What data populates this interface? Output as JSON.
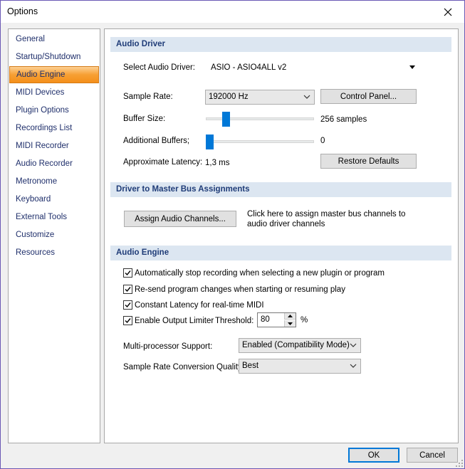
{
  "window": {
    "title": "Options"
  },
  "sidebar": {
    "items": [
      {
        "label": "General"
      },
      {
        "label": "Startup/Shutdown"
      },
      {
        "label": "Audio Engine"
      },
      {
        "label": "MIDI Devices"
      },
      {
        "label": "Plugin Options"
      },
      {
        "label": "Recordings List"
      },
      {
        "label": "MIDI Recorder"
      },
      {
        "label": "Audio Recorder"
      },
      {
        "label": "Metronome"
      },
      {
        "label": "Keyboard"
      },
      {
        "label": "External Tools"
      },
      {
        "label": "Customize"
      },
      {
        "label": "Resources"
      }
    ],
    "selected": "Audio Engine",
    "selected_color": "#f7a033"
  },
  "audio_driver": {
    "header": "Audio Driver",
    "select_label": "Select Audio Driver:",
    "driver_value": "ASIO - ASIO4ALL v2",
    "sample_rate_label": "Sample Rate:",
    "sample_rate_value": "192000 Hz",
    "control_panel_button": "Control Panel...",
    "buffer_size_label": "Buffer Size:",
    "buffer_size_value": "256 samples",
    "buffer_size_level": 0.16,
    "additional_buffers_label": "Additional Buffers;",
    "additional_buffers_value": "0",
    "additional_buffers_level": 0.0,
    "latency_label": "Approximate Latency:",
    "latency_value": "1,3 ms",
    "restore_defaults_button": "Restore Defaults"
  },
  "bus": {
    "header": "Driver to Master Bus Assignments",
    "assign_button": "Assign Audio Channels...",
    "help_line1": "Click here to assign master bus channels to",
    "help_line2": "audio driver channels"
  },
  "engine": {
    "header": "Audio Engine",
    "options": [
      {
        "label": "Automatically stop recording when selecting a new plugin or program",
        "checked": true
      },
      {
        "label": "Re-send program changes when starting or resuming play",
        "checked": true
      },
      {
        "label": "Constant Latency for real-time MIDI",
        "checked": true
      },
      {
        "label": "Enable Output Limiter",
        "checked": true
      }
    ],
    "threshold_label": "Threshold:",
    "threshold_value": "80",
    "threshold_unit": "%",
    "multiprocessor_label": "Multi-processor Support:",
    "multiprocessor_value": "Enabled (Compatibility Mode)",
    "src_quality_label": "Sample Rate Conversion Quality:",
    "src_quality_value": "Best"
  },
  "footer": {
    "ok": "OK",
    "cancel": "Cancel"
  },
  "colors": {
    "accent": "#0078d7",
    "section_bg": "#dce6f1",
    "section_text": "#1f3c78",
    "sidebar_text": "#1f2f6b"
  },
  "icons": {
    "close": "close-icon",
    "dropdown": "chevron-down-icon",
    "check": "check-icon",
    "grip": "resize-grip-icon"
  }
}
